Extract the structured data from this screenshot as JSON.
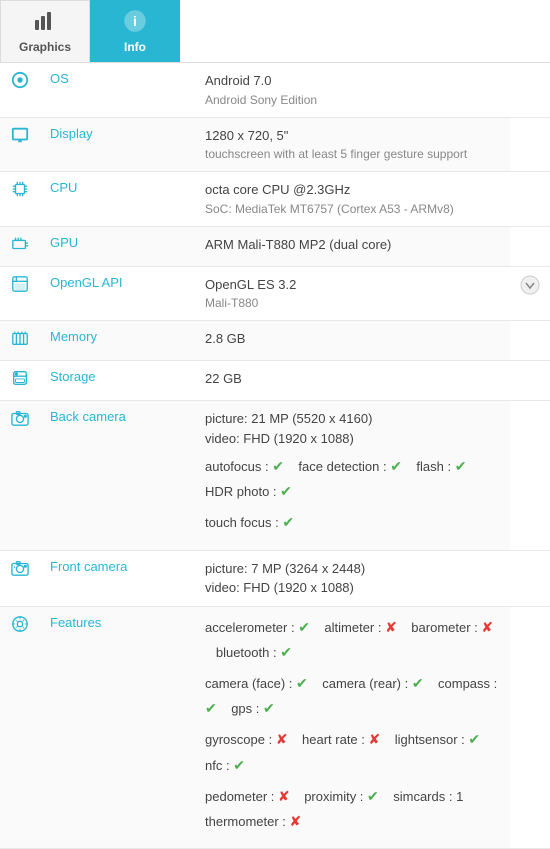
{
  "tabs": [
    {
      "id": "graphics",
      "label": "Graphics",
      "icon": "📊",
      "active": false
    },
    {
      "id": "info",
      "label": "Info",
      "icon": "ℹ",
      "active": true
    }
  ],
  "rows": [
    {
      "id": "os",
      "icon": "⚙",
      "label": "OS",
      "main": "Android 7.0",
      "sub": "Android Sony Edition"
    },
    {
      "id": "display",
      "icon": "🖥",
      "label": "Display",
      "main": "1280 x 720, 5\"",
      "sub": "touchscreen with at least 5 finger gesture support"
    },
    {
      "id": "cpu",
      "icon": "🔧",
      "label": "CPU",
      "main": "octa core CPU @2.3GHz",
      "sub": "SoC: MediaTek MT6757 (Cortex A53 - ARMv8)"
    },
    {
      "id": "gpu",
      "icon": "🎮",
      "label": "GPU",
      "main": "ARM Mali-T880 MP2 (dual core)",
      "sub": ""
    },
    {
      "id": "opengl",
      "icon": "🗂",
      "label": "OpenGL API",
      "main": "OpenGL ES 3.2",
      "sub": "Mali-T880",
      "dropdown": true
    },
    {
      "id": "memory",
      "icon": "💾",
      "label": "Memory",
      "main": "2.8 GB",
      "sub": ""
    },
    {
      "id": "storage",
      "icon": "📦",
      "label": "Storage",
      "main": "22 GB",
      "sub": ""
    },
    {
      "id": "back-camera",
      "icon": "📷",
      "label": "Back camera",
      "custom": "back-camera"
    },
    {
      "id": "front-camera",
      "icon": "🎥",
      "label": "Front camera",
      "custom": "front-camera"
    },
    {
      "id": "features",
      "icon": "⚙",
      "label": "Features",
      "custom": "features"
    }
  ],
  "back_camera": {
    "picture": "picture: 21 MP (5520 x 4160)",
    "video": "video: FHD (1920 x 1088)",
    "autofocus_label": "autofocus :",
    "autofocus": true,
    "face_detection_label": "face detection :",
    "face_detection": true,
    "flash_label": "flash :",
    "flash": true,
    "hdr_label": "HDR photo :",
    "hdr": true,
    "touch_focus_label": "touch focus :",
    "touch_focus": true
  },
  "front_camera": {
    "picture": "picture: 7 MP (3264 x 2448)",
    "video": "video: FHD (1920 x 1088)"
  },
  "features": {
    "accelerometer_label": "accelerometer :",
    "accelerometer": true,
    "altimeter_label": "altimeter :",
    "altimeter": false,
    "barometer_label": "barometer :",
    "barometer": false,
    "bluetooth_label": "bluetooth :",
    "bluetooth": true,
    "camera_face_label": "camera (face) :",
    "camera_face": true,
    "camera_rear_label": "camera (rear) :",
    "camera_rear": true,
    "compass_label": "compass :",
    "compass": true,
    "gps_label": "gps :",
    "gps": true,
    "gyroscope_label": "gyroscope :",
    "gyroscope": false,
    "heart_rate_label": "heart rate :",
    "heart_rate": false,
    "lightsensor_label": "lightsensor :",
    "lightsensor": true,
    "nfc_label": "nfc :",
    "nfc": true,
    "pedometer_label": "pedometer :",
    "pedometer": false,
    "proximity_label": "proximity :",
    "proximity": true,
    "simcards_label": "simcards :",
    "simcards": "1",
    "thermometer_label": "thermometer :",
    "thermometer": false
  },
  "colors": {
    "accent": "#29b6d2",
    "check": "#4caf50",
    "cross": "#e53935"
  }
}
